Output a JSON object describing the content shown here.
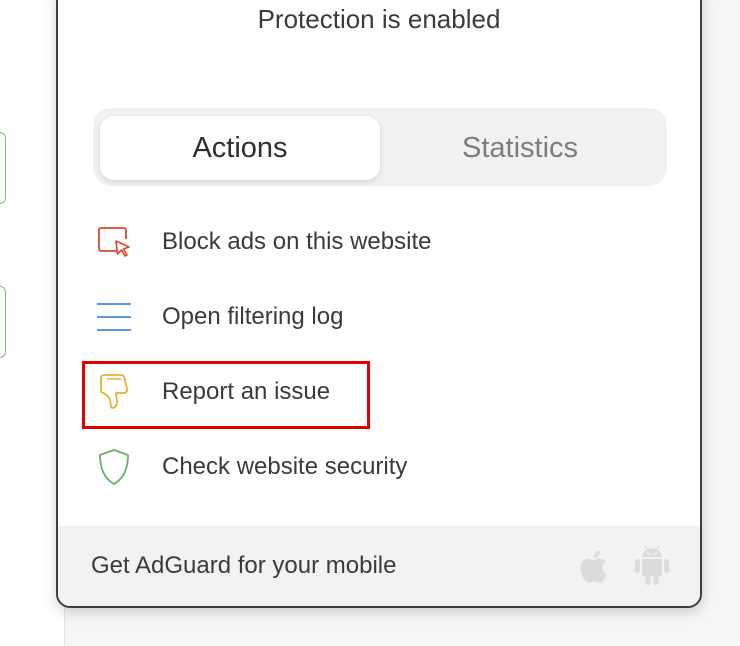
{
  "popup": {
    "status_text": "Protection is enabled",
    "tabs": [
      {
        "label": "Actions",
        "active": true
      },
      {
        "label": "Statistics",
        "active": false
      }
    ],
    "actions": [
      {
        "label": "Block ads on this website",
        "icon": "block-element-icon",
        "color": "#d9492b"
      },
      {
        "label": "Open filtering log",
        "icon": "filter-log-icon",
        "color": "#4a86d8"
      },
      {
        "label": "Report an issue",
        "icon": "thumbs-down-icon",
        "color": "#e8b132"
      },
      {
        "label": "Check website security",
        "icon": "shield-icon",
        "color": "#67b36a"
      }
    ],
    "footer": {
      "text": "Get AdGuard for your mobile",
      "icons": [
        "apple-icon",
        "android-icon"
      ]
    }
  },
  "highlight_color": "#e00000"
}
